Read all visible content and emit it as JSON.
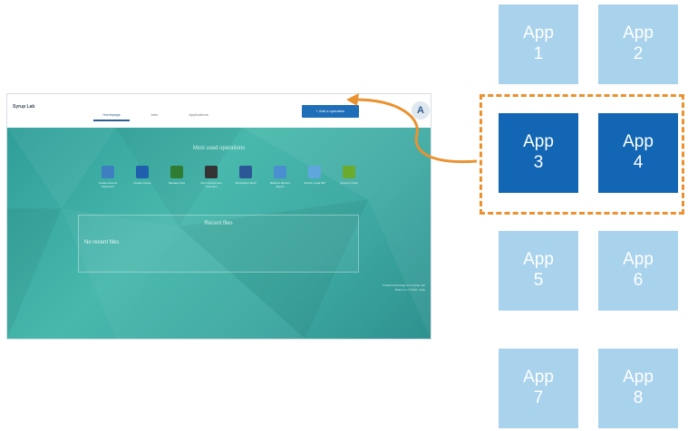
{
  "screenshot": {
    "logo": "Syrup Lab",
    "tabs": [
      "Homepage",
      "Jobs",
      "Applications"
    ],
    "action_button": "+ Add a operation",
    "avatar_letter": "A",
    "ops_title": "Most used operations",
    "operations": [
      {
        "label": "Create Account Statement",
        "icon": "document-icon",
        "color": "#3d7fbf"
      },
      {
        "label": "Create Invoice",
        "icon": "monitor-icon",
        "color": "#1f5fae"
      },
      {
        "label": "Manage Files",
        "icon": "spreadsheet-icon",
        "color": "#2e7d32"
      },
      {
        "label": "Open Assignment Overview",
        "icon": "record-icon",
        "color": "#333333"
      },
      {
        "label": "Workspace Word",
        "icon": "word-icon",
        "color": "#2b5797"
      },
      {
        "label": "Balance Monitor Report",
        "icon": "globe-icon",
        "color": "#4a8fd0"
      },
      {
        "label": "Search Legal RM",
        "icon": "window-icon",
        "color": "#5ea6dc"
      },
      {
        "label": "Approve Ticket",
        "icon": "checkmark-icon",
        "color": "#6aab2e"
      }
    ],
    "recent_title": "Recent files",
    "recent_empty": "No recent files",
    "footer_lines": [
      "Contact technology from Syrup Lab",
      "Build 2.0 • © 2016 • Help"
    ]
  },
  "apps": [
    {
      "word": "App",
      "number": "1",
      "state": "light"
    },
    {
      "word": "App",
      "number": "2",
      "state": "light"
    },
    {
      "word": "App",
      "number": "3",
      "state": "dark"
    },
    {
      "word": "App",
      "number": "4",
      "state": "dark"
    },
    {
      "word": "App",
      "number": "5",
      "state": "light"
    },
    {
      "word": "App",
      "number": "6",
      "state": "light"
    },
    {
      "word": "App",
      "number": "7",
      "state": "light"
    },
    {
      "word": "App",
      "number": "8",
      "state": "light"
    }
  ],
  "colors": {
    "app_light": "#a9d2ec",
    "app_dark": "#1266b4",
    "highlight": "#ea922f",
    "teal": "#3fa9a2"
  }
}
